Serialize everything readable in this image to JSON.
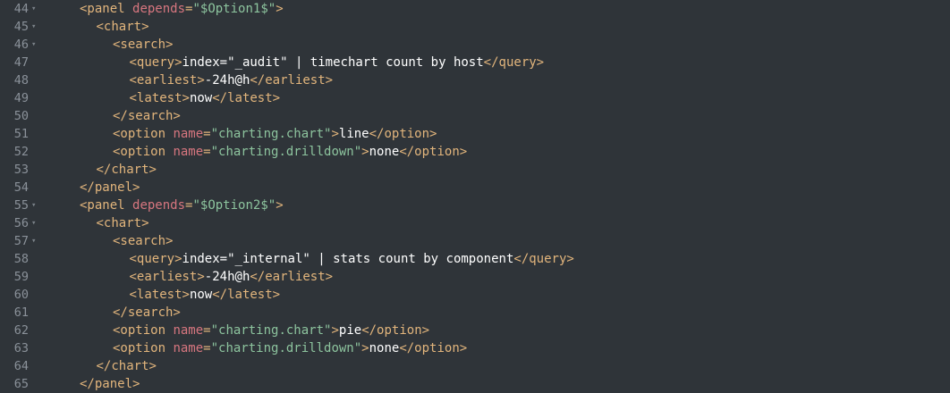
{
  "editor": {
    "colors": {
      "background": "#2f3439",
      "tag": "#e2b57c",
      "attribute": "#d7767f",
      "string": "#8dc49e",
      "text": "#ffffff",
      "line_number": "#8a9199"
    },
    "lines": [
      {
        "num": "44",
        "fold": "▾",
        "indent": 2,
        "tokens": [
          [
            "tag",
            "<panel "
          ],
          [
            "attr",
            "depends"
          ],
          [
            "tag",
            "="
          ],
          [
            "str",
            "\"$Option1$\""
          ],
          [
            "tag",
            ">"
          ]
        ]
      },
      {
        "num": "45",
        "fold": "▾",
        "indent": 3,
        "tokens": [
          [
            "tag",
            "<chart>"
          ]
        ]
      },
      {
        "num": "46",
        "fold": "▾",
        "indent": 4,
        "tokens": [
          [
            "tag",
            "<search>"
          ]
        ]
      },
      {
        "num": "47",
        "fold": "",
        "indent": 5,
        "tokens": [
          [
            "tag",
            "<query>"
          ],
          [
            "txt",
            "index=\"_audit\" | timechart count by host"
          ],
          [
            "tag",
            "</query>"
          ]
        ]
      },
      {
        "num": "48",
        "fold": "",
        "indent": 5,
        "tokens": [
          [
            "tag",
            "<earliest>"
          ],
          [
            "txt",
            "-24h@h"
          ],
          [
            "tag",
            "</earliest>"
          ]
        ]
      },
      {
        "num": "49",
        "fold": "",
        "indent": 5,
        "tokens": [
          [
            "tag",
            "<latest>"
          ],
          [
            "txt",
            "now"
          ],
          [
            "tag",
            "</latest>"
          ]
        ]
      },
      {
        "num": "50",
        "fold": "",
        "indent": 4,
        "tokens": [
          [
            "tag",
            "</search>"
          ]
        ]
      },
      {
        "num": "51",
        "fold": "",
        "indent": 4,
        "tokens": [
          [
            "tag",
            "<option "
          ],
          [
            "attr",
            "name"
          ],
          [
            "tag",
            "="
          ],
          [
            "str",
            "\"charting.chart\""
          ],
          [
            "tag",
            ">"
          ],
          [
            "txt",
            "line"
          ],
          [
            "tag",
            "</option>"
          ]
        ]
      },
      {
        "num": "52",
        "fold": "",
        "indent": 4,
        "tokens": [
          [
            "tag",
            "<option "
          ],
          [
            "attr",
            "name"
          ],
          [
            "tag",
            "="
          ],
          [
            "str",
            "\"charting.drilldown\""
          ],
          [
            "tag",
            ">"
          ],
          [
            "txt",
            "none"
          ],
          [
            "tag",
            "</option>"
          ]
        ]
      },
      {
        "num": "53",
        "fold": "",
        "indent": 3,
        "tokens": [
          [
            "tag",
            "</chart>"
          ]
        ]
      },
      {
        "num": "54",
        "fold": "",
        "indent": 2,
        "tokens": [
          [
            "tag",
            "</panel>"
          ]
        ]
      },
      {
        "num": "55",
        "fold": "▾",
        "indent": 2,
        "tokens": [
          [
            "tag",
            "<panel "
          ],
          [
            "attr",
            "depends"
          ],
          [
            "tag",
            "="
          ],
          [
            "str",
            "\"$Option2$\""
          ],
          [
            "tag",
            ">"
          ]
        ]
      },
      {
        "num": "56",
        "fold": "▾",
        "indent": 3,
        "tokens": [
          [
            "tag",
            "<chart>"
          ]
        ]
      },
      {
        "num": "57",
        "fold": "▾",
        "indent": 4,
        "tokens": [
          [
            "tag",
            "<search>"
          ]
        ]
      },
      {
        "num": "58",
        "fold": "",
        "indent": 5,
        "tokens": [
          [
            "tag",
            "<query>"
          ],
          [
            "txt",
            "index=\"_internal\" | stats count by component"
          ],
          [
            "tag",
            "</query>"
          ]
        ]
      },
      {
        "num": "59",
        "fold": "",
        "indent": 5,
        "tokens": [
          [
            "tag",
            "<earliest>"
          ],
          [
            "txt",
            "-24h@h"
          ],
          [
            "tag",
            "</earliest>"
          ]
        ]
      },
      {
        "num": "60",
        "fold": "",
        "indent": 5,
        "tokens": [
          [
            "tag",
            "<latest>"
          ],
          [
            "txt",
            "now"
          ],
          [
            "tag",
            "</latest>"
          ]
        ]
      },
      {
        "num": "61",
        "fold": "",
        "indent": 4,
        "tokens": [
          [
            "tag",
            "</search>"
          ]
        ]
      },
      {
        "num": "62",
        "fold": "",
        "indent": 4,
        "tokens": [
          [
            "tag",
            "<option "
          ],
          [
            "attr",
            "name"
          ],
          [
            "tag",
            "="
          ],
          [
            "str",
            "\"charting.chart\""
          ],
          [
            "tag",
            ">"
          ],
          [
            "txt",
            "pie"
          ],
          [
            "tag",
            "</option>"
          ]
        ]
      },
      {
        "num": "63",
        "fold": "",
        "indent": 4,
        "tokens": [
          [
            "tag",
            "<option "
          ],
          [
            "attr",
            "name"
          ],
          [
            "tag",
            "="
          ],
          [
            "str",
            "\"charting.drilldown\""
          ],
          [
            "tag",
            ">"
          ],
          [
            "txt",
            "none"
          ],
          [
            "tag",
            "</option>"
          ]
        ]
      },
      {
        "num": "64",
        "fold": "",
        "indent": 3,
        "tokens": [
          [
            "tag",
            "</chart>"
          ]
        ]
      },
      {
        "num": "65",
        "fold": "",
        "indent": 2,
        "tokens": [
          [
            "tag",
            "</panel>"
          ]
        ]
      }
    ]
  }
}
